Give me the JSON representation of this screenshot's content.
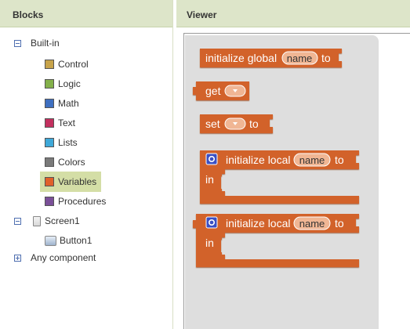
{
  "blocks_panel": {
    "title": "Blocks",
    "built_in": {
      "label": "Built-in",
      "categories": [
        {
          "label": "Control",
          "color": "#c7a34a"
        },
        {
          "label": "Logic",
          "color": "#83b04a"
        },
        {
          "label": "Math",
          "color": "#3e6fc0"
        },
        {
          "label": "Text",
          "color": "#c3305f"
        },
        {
          "label": "Lists",
          "color": "#3ea8d8"
        },
        {
          "label": "Colors",
          "color": "#7a7a7a"
        },
        {
          "label": "Variables",
          "color": "#e0602a"
        },
        {
          "label": "Procedures",
          "color": "#7a4f98"
        }
      ]
    },
    "screen": {
      "label": "Screen1",
      "children": [
        {
          "label": "Button1"
        }
      ]
    },
    "any_component": {
      "label": "Any component"
    }
  },
  "viewer": {
    "title": "Viewer",
    "blocks": {
      "init_global": {
        "text": "initialize global",
        "field": "name",
        "suffix": "to"
      },
      "get": {
        "text": "get"
      },
      "set": {
        "text": "set",
        "suffix": "to"
      },
      "init_local_1": {
        "text": "initialize local",
        "field": "name",
        "suffix": "to",
        "in_label": "in"
      },
      "init_local_2": {
        "text": "initialize local",
        "field": "name",
        "suffix": "to",
        "in_label": "in"
      }
    },
    "block_color": "#d2622c"
  }
}
